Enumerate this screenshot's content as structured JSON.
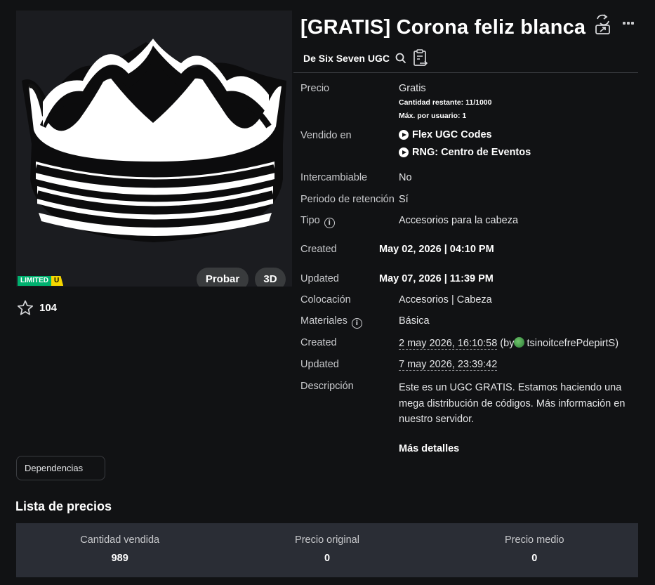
{
  "item": {
    "title": "[GRATIS] Corona feliz blanca",
    "creator_label": "De Six Seven UGC",
    "favorites": "104",
    "limited_label": "LIMITED",
    "limited_u": "U",
    "try_button": "Probar",
    "view3d_button": "3D"
  },
  "details": {
    "price_label": "Precio",
    "price_value": "Gratis",
    "quantity_left": "Cantidad restante: 11/1000",
    "max_per_user": "Máx. por usuario: 1",
    "sold_in_label": "Vendido en",
    "sold_in": [
      "Flex UGC Codes",
      "RNG: Centro de Eventos"
    ],
    "tradable_label": "Intercambiable",
    "tradable_value": "No",
    "holding_label": "Periodo de retención",
    "holding_value": "Sí",
    "type_label": "Tipo",
    "type_value": "Accesorios para la cabeza",
    "created_label": "Created",
    "created_value": "May 02, 2026 | 04:10 PM",
    "updated_label": "Updated",
    "updated_value": "May 07, 2026 | 11:39 PM",
    "placement_label": "Colocación",
    "placement_value": "Accesorios | Cabeza",
    "materials_label": "Materiales",
    "materials_value": "Básica",
    "created2_label": "Created",
    "created2_value": "2 may 2026, 16:10:58",
    "created2_by_prefix": "(by",
    "created2_by_user": "tsinoitcefrePdepirtS",
    "created2_by_suffix": ")",
    "updated2_label": "Updated",
    "updated2_value": "7 may 2026, 23:39:42",
    "description_label": "Descripción",
    "description": "Este es un UGC GRATIS. Estamos haciendo una mega distribución de códigos. Más información en nuestro servidor.",
    "more_details": "Más detalles"
  },
  "dependencies_button": "Dependencias",
  "price_list": {
    "title": "Lista de precios",
    "columns": [
      {
        "header": "Cantidad vendida",
        "value": "989"
      },
      {
        "header": "Precio original",
        "value": "0"
      },
      {
        "header": "Precio medio",
        "value": "0"
      }
    ]
  },
  "colors": {
    "background": "#111214",
    "limited_green": "#00b06f",
    "limited_yellow": "#f6d700",
    "table_bg": "#2a2d35"
  },
  "icons": [
    "star-icon",
    "search-icon",
    "clipboard-icon",
    "share-icon",
    "more-icon",
    "play-icon",
    "info-icon"
  ]
}
